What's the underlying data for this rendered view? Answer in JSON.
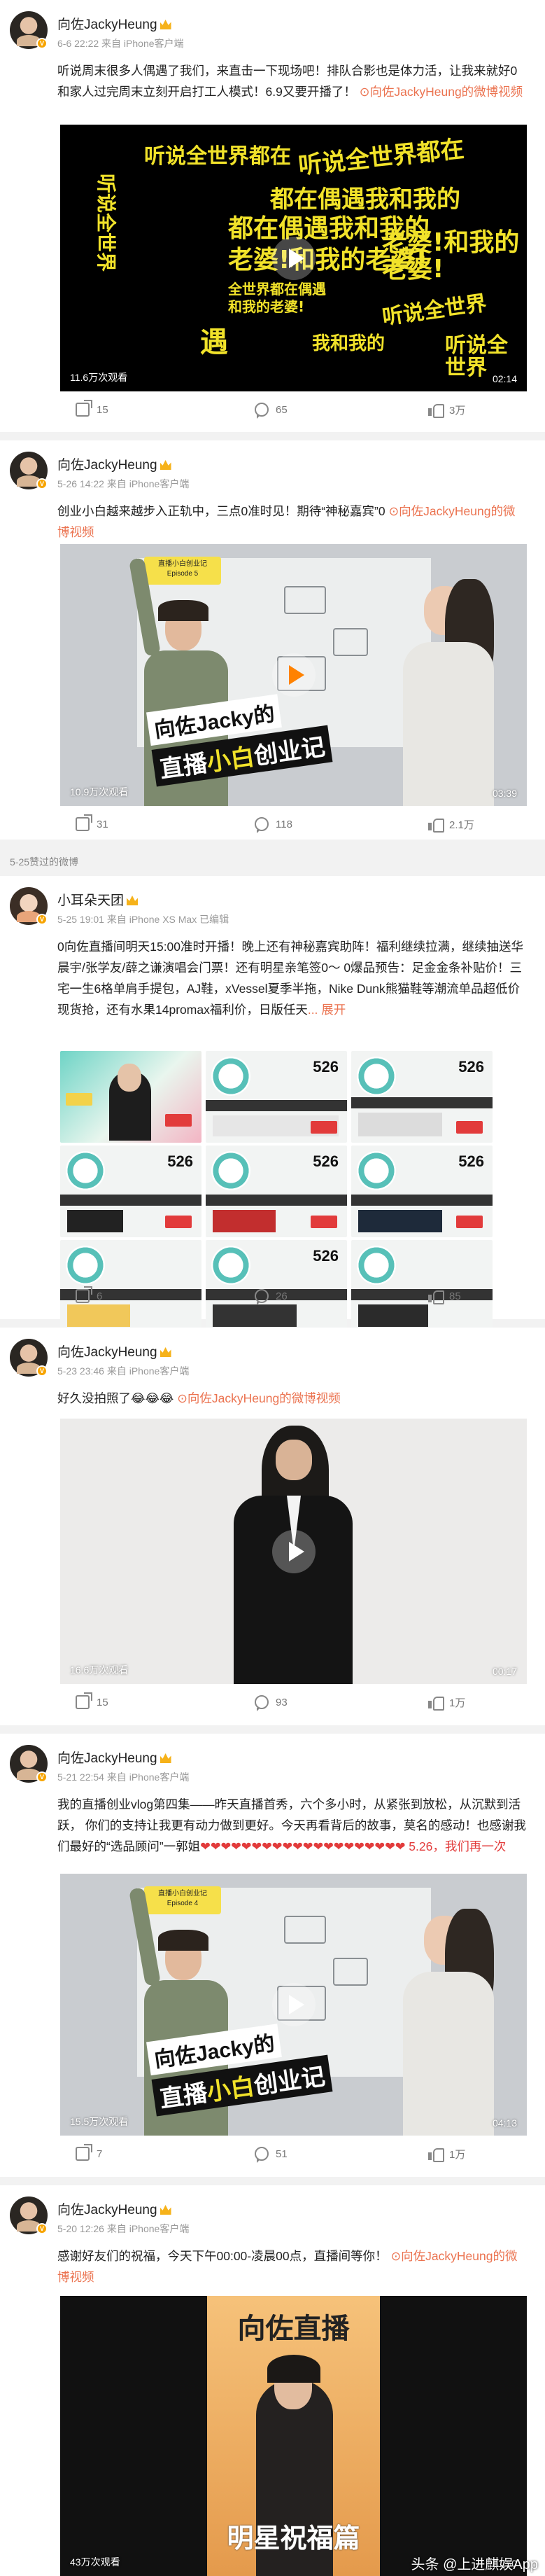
{
  "posts": [
    {
      "username": "向佐JackyHeung",
      "meta": "6-6 22:22  来自 iPhone客户端",
      "text": "听说周末很多人偶遇了我们，来直击一下现场吧！排队合影也是体力活，让我来就好0 和家人过完周末立刻开启打工人模式！6.9又要开播了！",
      "link": "向佐JackyHeung的微博视频",
      "video_text": [
        "听说全世界都在",
        "都在偶遇我和我的",
        "老婆!和我的老婆!",
        "全世界都在偶遇",
        "和我的老婆!",
        "听说全世界",
        "我和我的",
        "遇"
      ],
      "views": "11.6万次观看",
      "duration": "02:14",
      "shares": "15",
      "comments": "65",
      "likes": "3万"
    },
    {
      "username": "向佐JackyHeung",
      "meta": "5-26 14:22  来自 iPhone客户端",
      "text": "创业小白越来越步入正轨中，三点0准时见！期待“神秘嘉宾”0",
      "link": "向佐JackyHeung的微博视频",
      "caption": "向佐Jacky的 直播小白创业记",
      "episode": "Episode 5",
      "views": "10.9万次观看",
      "duration": "03:39",
      "shares": "31",
      "comments": "118",
      "likes": "2.1万"
    },
    {
      "repost_header": "5-25赞过的微博",
      "username": "小耳朵天团",
      "meta": "5-25 19:01  来自 iPhone XS Max 已编辑",
      "text": "0向佐直播间明天15:00准时开播！晚上还有神秘嘉宾助阵！福利继续拉满，继续抽送华晨宇/张学友/薛之谦演唱会门票！还有明星亲笔签0～ 0爆品预告：足金金条补贴价！三宅一生6格单肩手提包，AJ鞋，xVessel夏季半拖，Nike Dunk熊猫鞋等潮流单品超低价现货抢，还有水果14promax福利价，日版任天",
      "fold": "... 展开",
      "grid_labels": [
        "526",
        "526",
        "526",
        "526",
        "526",
        "526"
      ],
      "shares": "6",
      "comments": "26",
      "likes": "85"
    },
    {
      "username": "向佐JackyHeung",
      "meta": "5-23 23:46  来自 iPhone客户端",
      "text": "好久没拍照了",
      "link": "向佐JackyHeung的微博视频",
      "views": "16.6万次观看",
      "duration": "00:17",
      "shares": "15",
      "comments": "93",
      "likes": "1万"
    },
    {
      "username": "向佐JackyHeung",
      "meta": "5-21 22:54  来自 iPhone客户端",
      "text": "我的直播创业vlog第四集——昨天直播首秀，六个多小时，从紧张到放松，从沉默到活跃， 你们的支持让我更有动力做到更好。今天再看背后的故事，莫名的感动！也感谢我们最好的“选品顾问”一郭姐",
      "hearts": "❤❤❤❤❤❤❤❤❤❤❤❤❤❤❤❤❤❤❤❤ 5.26，我们再一次",
      "caption": "向佐Jacky的 直播小白创业记",
      "episode": "Episode 4",
      "views": "15.5万次观看",
      "duration": "04:13",
      "shares": "7",
      "comments": "51",
      "likes": "1万"
    },
    {
      "username": "向佐JackyHeung",
      "meta": "5-20 12:26  来自 iPhone客户端",
      "text": "感谢好友们的祝福，今天下午00:00-凌晨00点，直播间等你！",
      "link": "向佐JackyHeung的微博视频",
      "poster_title": "向佐直播",
      "poster_sub": "明星祝福篇",
      "views": "43万次观看",
      "duration": "01:50",
      "watermark": "头条 @上进麒娱App"
    }
  ]
}
